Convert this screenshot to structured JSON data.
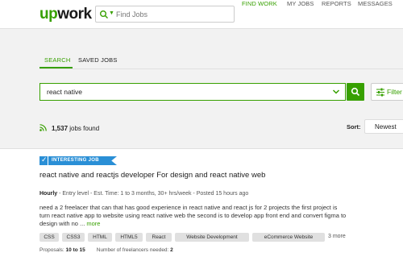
{
  "nav": {
    "logo": {
      "up": "up",
      "work": "work"
    },
    "search_placeholder": "Find Jobs",
    "links": [
      "FIND WORK",
      "MY JOBS",
      "REPORTS",
      "MESSAGES"
    ],
    "active_link": "FIND WORK"
  },
  "tabs": [
    "SEARCH",
    "SAVED JOBS"
  ],
  "search": {
    "value": "react native",
    "filter_label": "Filter"
  },
  "results": {
    "count": "1,537",
    "count_suffix": " jobs found",
    "sort_label": "Sort:",
    "sort_value": "Newest"
  },
  "job": {
    "badge": "INTERESTING JOB",
    "title": "react native and reactjs developer For design and react native web",
    "type": "Hourly",
    "meta": " - Entry level - Est. Time: 1 to 3 months, 30+ hrs/week - Posted 15 hours ago",
    "description_line1": "need a 2 freelacer that can that has good experience in react native and react js for 2 projects the first project is",
    "description_line2": "turn react native app to website using react native web the second is to develop app front end and convert figma to",
    "description_line3": "design with no ...",
    "more_link": "more",
    "skills": [
      "CSS",
      "CSS3",
      "HTML",
      "HTML5",
      "React",
      "Website Development",
      "eCommerce Website"
    ],
    "more_skills": "3 more",
    "proposals_label": "Proposals: ",
    "proposals_value": "10 to 15",
    "freelancers_label": "Number of freelancers needed: ",
    "freelancers_value": "2"
  },
  "colors": {
    "brand_green": "#37a000",
    "badge_blue": "#2a8fd6"
  }
}
